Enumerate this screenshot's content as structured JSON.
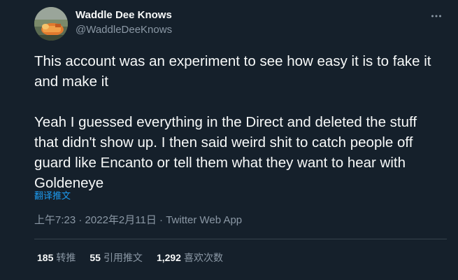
{
  "author": {
    "display_name": "Waddle Dee Knows",
    "handle": "@WaddleDeeKnows"
  },
  "tweet": {
    "paragraphs": [
      "This account was an experiment to see how easy it is to fake it and make it",
      "Yeah I guessed everything in the Direct and deleted the stuff that didn't show up. I then said weird shit to catch people off guard like Encanto or tell them what they want to hear with Goldeneye"
    ],
    "translate_label": "翻译推文"
  },
  "meta": {
    "time": "上午7:23",
    "separator1": " · ",
    "date": "2022年2月11日",
    "separator2": " · ",
    "source": "Twitter Web App"
  },
  "stats": {
    "retweets_count": "185",
    "retweets_label": "转推",
    "quotes_count": "55",
    "quotes_label": "引用推文",
    "likes_count": "1,292",
    "likes_label": "喜欢次数"
  },
  "icons": {
    "more": "more-horizontal-icon"
  },
  "colors": {
    "background": "#15202b",
    "text_primary": "#f7f9f9",
    "text_secondary": "#8b98a5",
    "accent": "#1d9bf0",
    "divider": "#38444d"
  }
}
